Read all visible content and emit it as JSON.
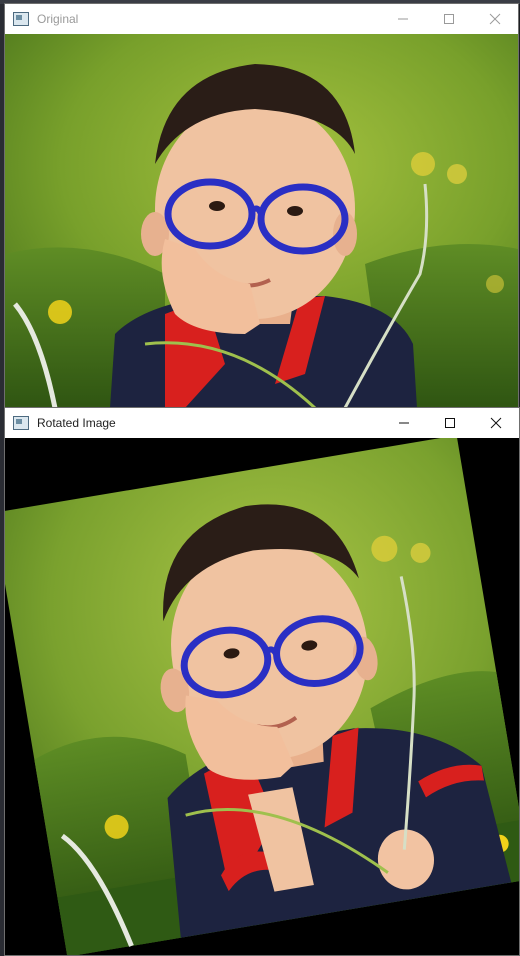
{
  "windows": {
    "original": {
      "title": "Original",
      "controls": [
        "minimize-icon",
        "maximize-icon",
        "close-icon"
      ]
    },
    "rotated": {
      "title": "Rotated Image",
      "controls": [
        "minimize-icon",
        "maximize-icon",
        "close-icon"
      ]
    }
  },
  "colors": {
    "glasses": "#2a2fc4",
    "shirt": "#1d2340",
    "collar": "#d8201e",
    "background_green": "#7aa12e",
    "grass": "#3f6b1a",
    "flower": "#f1d21a"
  }
}
